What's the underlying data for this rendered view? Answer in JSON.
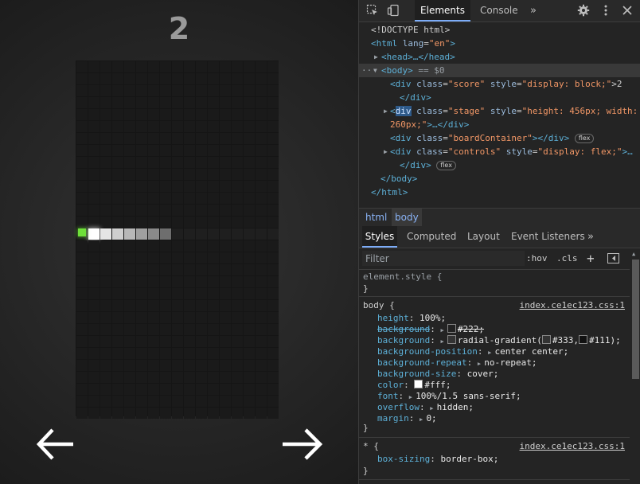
{
  "game": {
    "score": "2",
    "cells_lit": [
      {
        "col": 1,
        "color": "#ffffff"
      },
      {
        "col": 2,
        "color": "#e5e5e5"
      },
      {
        "col": 3,
        "color": "#cfcfcf"
      },
      {
        "col": 4,
        "color": "#b8b8b8"
      },
      {
        "col": 5,
        "color": "#a0a0a0"
      },
      {
        "col": 6,
        "color": "#8a8a8a"
      },
      {
        "col": 7,
        "color": "#6e6e6e"
      },
      {
        "col": 8,
        "color": "#1f1f1f"
      },
      {
        "col": 9,
        "color": "#1f1f1f"
      },
      {
        "col": 10,
        "color": "#1f1f1f"
      },
      {
        "col": 11,
        "color": "#1f1f1f"
      },
      {
        "col": 12,
        "color": "#1f1f1f"
      },
      {
        "col": 13,
        "color": "#1f1f1f"
      },
      {
        "col": 14,
        "color": "#1f1f1f"
      },
      {
        "col": 15,
        "color": "#1f1f1f"
      },
      {
        "col": 16,
        "color": "#1f1f1f"
      }
    ],
    "head_color": "#6fe03a",
    "arrow_left_icon": "arrow-left-icon",
    "arrow_right_icon": "arrow-right-icon"
  },
  "devtools": {
    "tabs": [
      "Elements",
      "Console"
    ],
    "more_tabs": "»",
    "dom": {
      "doctype": "<!DOCTYPE html>",
      "html_open_tag": "<html",
      "html_lang_attr": " lang",
      "html_lang_val": "\"en\"",
      "html_close": ">",
      "head_collapsed": "<head>…</head>",
      "body_open": "<body>",
      "body_marker": " == $0",
      "score_div_open": "<div",
      "score_class_attr": " class",
      "score_class_val": "\"score\"",
      "score_style_attr": " style",
      "score_style_val": "\"display: block;\"",
      "score_text": ">2",
      "div_close": "</div>",
      "stage_div_open": "div",
      "stage_class_val": "\"stage\"",
      "stage_style_val": "\"height: 456px; width:",
      "stage_style_cont": "260px;\"",
      "stage_tail": ">…</div>",
      "board_class_val": "\"boardContainer\"",
      "board_tail": "></div>",
      "controls_class_val": "\"controls\"",
      "controls_style_val": "\"display: flex;\"",
      "controls_tail": ">…",
      "flex_badge": "flex",
      "body_close": "</body>",
      "html_close_tag": "</html>"
    },
    "breadcrumbs": [
      "html",
      "body"
    ],
    "style_tabs": [
      "Styles",
      "Computed",
      "Layout",
      "Event Listeners"
    ],
    "filter": {
      "placeholder": "Filter",
      "hov": ":hov",
      "cls": ".cls",
      "plus": "+"
    },
    "styles": {
      "element_style_selector": "element.style {",
      "close_brace": "}",
      "body_selector": "body {",
      "body_source": "index.ce1ec123.css:1",
      "rules": [
        {
          "prop": "height",
          "value": "100%;"
        },
        {
          "prop": "background",
          "value": "#222;",
          "swatch": "#222222",
          "struck": true
        },
        {
          "prop": "background",
          "value": "radial-gradient(#333, #111);",
          "swatch": "#333333",
          "swatch2": "#111111"
        },
        {
          "prop": "background-position",
          "value": "center center;"
        },
        {
          "prop": "background-repeat",
          "value": "no-repeat;"
        },
        {
          "prop": "background-size",
          "value": "cover;"
        },
        {
          "prop": "color",
          "value": "#fff;",
          "swatch": "#ffffff"
        },
        {
          "prop": "font",
          "value": "100%/1.5 sans-serif;"
        },
        {
          "prop": "overflow",
          "value": "hidden;"
        },
        {
          "prop": "margin",
          "value": "0;"
        }
      ],
      "star_selector": "* {",
      "star_source": "index.ce1ec123.css:1",
      "star_rule_prop": "box-sizing",
      "star_rule_value": "border-box;"
    }
  }
}
